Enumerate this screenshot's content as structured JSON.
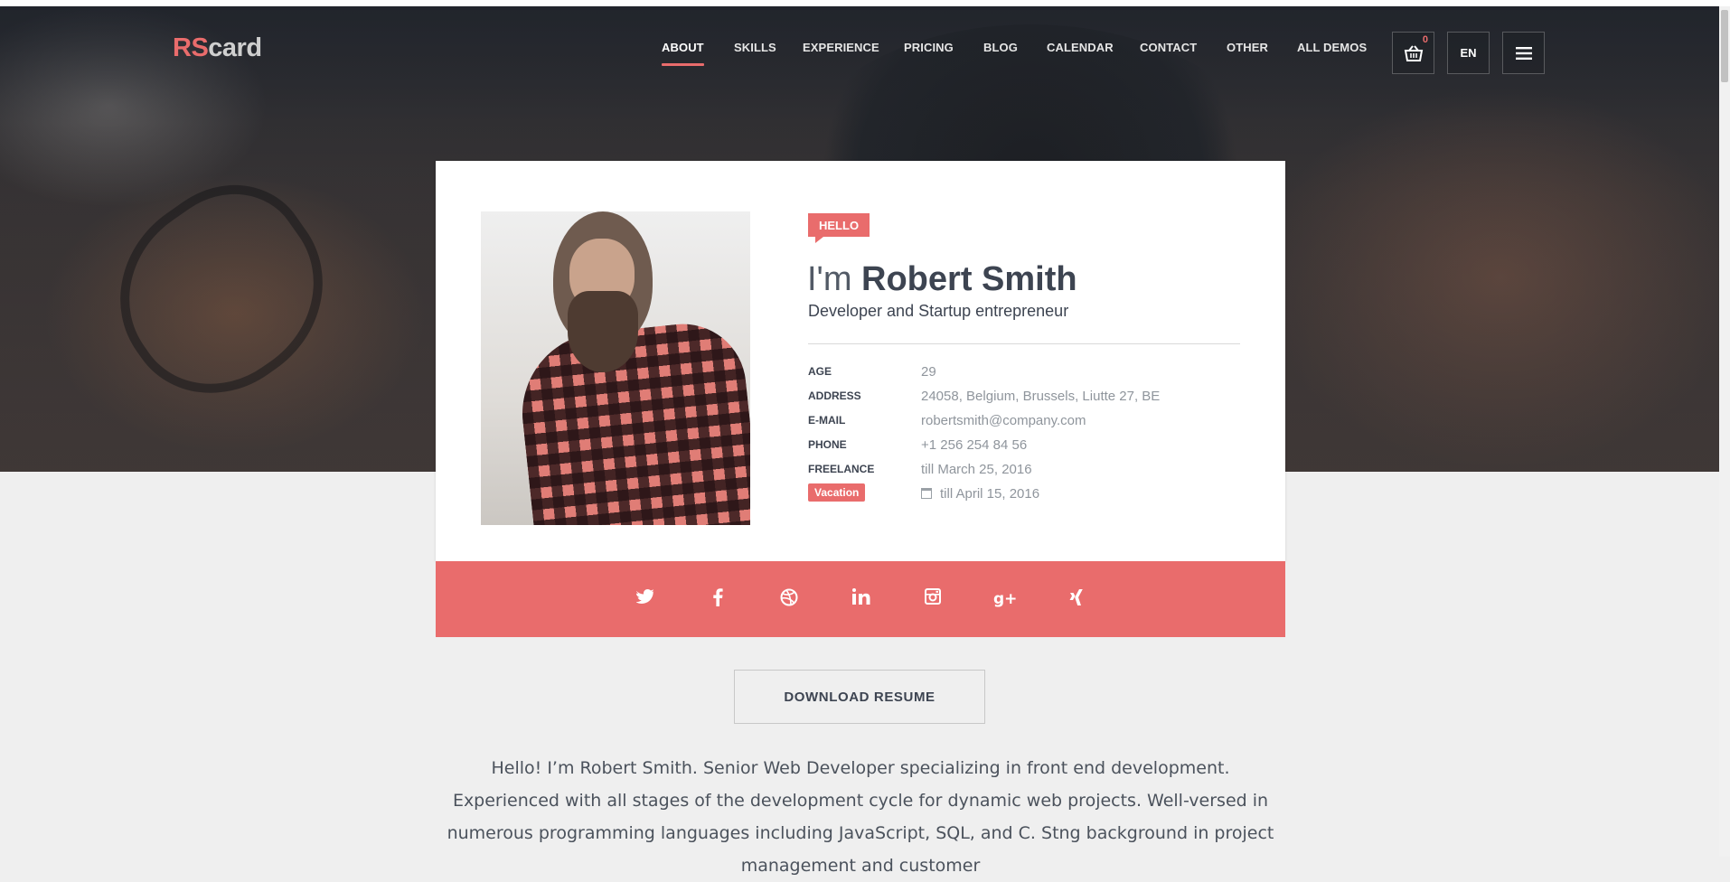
{
  "brand": {
    "logo_part1": "RS",
    "logo_part2": "card"
  },
  "nav": {
    "items": [
      "ABOUT",
      "SKILLS",
      "EXPERIENCE",
      "PRICING",
      "BLOG",
      "CALENDAR",
      "CONTACT",
      "OTHER",
      "ALL DEMOS"
    ],
    "active": "ABOUT",
    "cart_count": "0",
    "language": "EN"
  },
  "profile": {
    "greeting_badge": "HELLO",
    "name_prefix": "I'm",
    "name": "Robert Smith",
    "title": "Developer and Startup entrepreneur",
    "info": [
      {
        "label": "AGE",
        "value": "29"
      },
      {
        "label": "ADDRESS",
        "value": "24058, Belgium, Brussels, Liutte 27, BE"
      },
      {
        "label": "E-MAIL",
        "value": "robertsmith@company.com"
      },
      {
        "label": "PHONE",
        "value": "+1 256 254 84 56"
      },
      {
        "label": "FREELANCE",
        "value": "till March 25, 2016"
      }
    ],
    "vacation": {
      "badge": "Vacation",
      "value": "till April 15, 2016"
    }
  },
  "social": {
    "icons": [
      "twitter-icon",
      "facebook-icon",
      "dribbble-icon",
      "linkedin-icon",
      "instagram-icon",
      "google-plus-icon",
      "xing-icon"
    ]
  },
  "actions": {
    "download_label": "DOWNLOAD RESUME"
  },
  "bio": {
    "text": "Hello! I’m Robert Smith. Senior Web Developer specializing in front end development. Experienced with all stages of the development cycle for dynamic web projects. Well-versed in numerous programming languages including JavaScript, SQL, and C. Stng background in project management and customer"
  },
  "colors": {
    "accent": "#e96c6c",
    "text_dark": "#3d4451",
    "text_muted": "#8f959c",
    "page_bg": "#efefef"
  }
}
